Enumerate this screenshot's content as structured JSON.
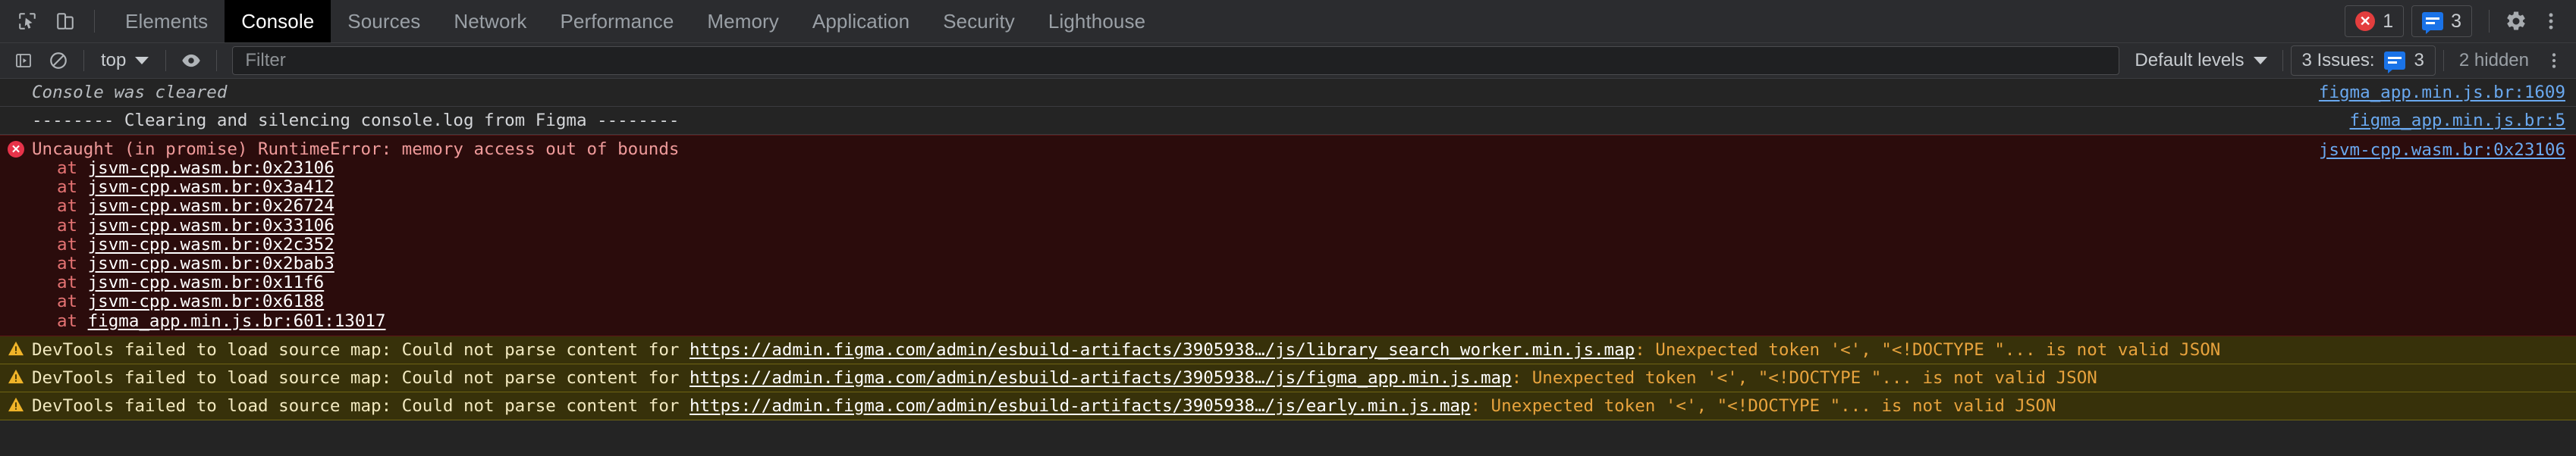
{
  "window": {
    "title": "Chrome DevTools Console"
  },
  "tabbar": {
    "inspect_icon": "inspect-cursor-icon",
    "device_icon": "device-toolbar-icon",
    "tabs": [
      {
        "label": "Elements",
        "selected": false
      },
      {
        "label": "Console",
        "selected": true
      },
      {
        "label": "Sources",
        "selected": false
      },
      {
        "label": "Network",
        "selected": false
      },
      {
        "label": "Performance",
        "selected": false
      },
      {
        "label": "Memory",
        "selected": false
      },
      {
        "label": "Application",
        "selected": false
      },
      {
        "label": "Security",
        "selected": false
      },
      {
        "label": "Lighthouse",
        "selected": false
      }
    ],
    "error_count": "1",
    "message_count": "3",
    "settings_icon": "gear-icon",
    "more_icon": "more-vertical-icon"
  },
  "filterbar": {
    "sidebar_toggle_icon": "console-sidebar-icon",
    "clear_icon": "clear-console-icon",
    "context": "top",
    "eye_icon": "live-expression-icon",
    "filter_placeholder": "Filter",
    "filter_value": "",
    "levels_label": "Default levels",
    "issues_label": "3 Issues:",
    "issues_count": "3",
    "hidden_label": "2 hidden",
    "settings_icon": "settings-gear-icon"
  },
  "console": {
    "cleared_message": "Console was cleared",
    "cleared_source": "figma_app.min.js.br:1609",
    "log_message": "-------- Clearing and silencing console.log from Figma --------",
    "log_source": "figma_app.min.js.br:5",
    "error": {
      "title": "Uncaught (in promise) RuntimeError: memory access out of bounds",
      "source": "jsvm-cpp.wasm.br:0x23106",
      "frames": [
        {
          "at": "at",
          "link": "jsvm-cpp.wasm.br:0x23106"
        },
        {
          "at": "at",
          "link": "jsvm-cpp.wasm.br:0x3a412"
        },
        {
          "at": "at",
          "link": "jsvm-cpp.wasm.br:0x26724"
        },
        {
          "at": "at",
          "link": "jsvm-cpp.wasm.br:0x33106"
        },
        {
          "at": "at",
          "link": "jsvm-cpp.wasm.br:0x2c352"
        },
        {
          "at": "at",
          "link": "jsvm-cpp.wasm.br:0x2bab3"
        },
        {
          "at": "at",
          "link": "jsvm-cpp.wasm.br:0x11f6"
        },
        {
          "at": "at",
          "link": "jsvm-cpp.wasm.br:0x6188"
        },
        {
          "at": "at",
          "link": "figma_app.min.js.br:601:13017"
        }
      ]
    },
    "warnings": [
      {
        "prefix": "DevTools failed to load source map: Could not parse content for ",
        "url": "https://admin.figma.com/admin/esbuild-artifacts/3905938…/js/library_search_worker.min.js.map",
        "suffix": ": Unexpected token '<', \"<!DOCTYPE \"... is not valid JSON"
      },
      {
        "prefix": "DevTools failed to load source map: Could not parse content for ",
        "url": "https://admin.figma.com/admin/esbuild-artifacts/3905938…/js/figma_app.min.js.map",
        "suffix": ": Unexpected token '<', \"<!DOCTYPE \"... is not valid JSON"
      },
      {
        "prefix": "DevTools failed to load source map: Could not parse content for ",
        "url": "https://admin.figma.com/admin/esbuild-artifacts/3905938…/js/early.min.js.map",
        "suffix": ": Unexpected token '<', \"<!DOCTYPE \"... is not valid JSON"
      }
    ]
  },
  "colors": {
    "error_bg": "#2b0c0c",
    "warn_bg": "#37310a",
    "accent_blue": "#1a73e8",
    "link_blue": "#6aa9f0",
    "panel_bg": "#2b2c2f",
    "body_bg": "#242424"
  }
}
